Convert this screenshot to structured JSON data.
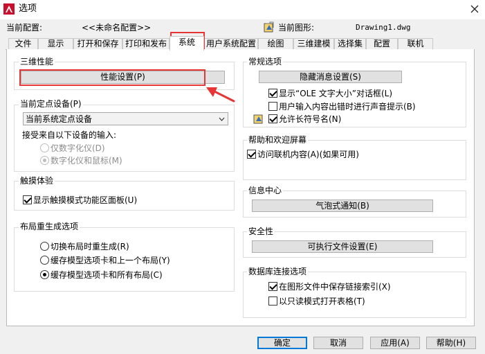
{
  "window": {
    "title": "选项"
  },
  "header": {
    "profile_label": "当前配置:",
    "profile_value": "<<未命名配置>>",
    "drawing_label": "当前图形:",
    "drawing_value": "Drawing1.dwg"
  },
  "tabs": [
    {
      "label": "文件"
    },
    {
      "label": "显示"
    },
    {
      "label": "打开和保存"
    },
    {
      "label": "打印和发布"
    },
    {
      "label": "系统"
    },
    {
      "label": "用户系统配置"
    },
    {
      "label": "绘图"
    },
    {
      "label": "三维建模"
    },
    {
      "label": "选择集"
    },
    {
      "label": "配置"
    },
    {
      "label": "联机"
    }
  ],
  "active_tab": "系统",
  "perf3d": {
    "title": "三维性能",
    "button": "性能设置(P)"
  },
  "pointing": {
    "title": "当前定点设备(P)",
    "selected": "当前系统定点设备",
    "accept_label": "接受来自以下设备的输入:",
    "opt_digitizer": "仅数字化仪(D)",
    "opt_digitizer_mouse": "数字化仪和鼠标(M)"
  },
  "touch": {
    "title": "触摸体验",
    "checkbox": "显示触摸模式功能区面板(U)"
  },
  "layout_regen": {
    "title": "布局重生成选项",
    "opt1": "切换布局时重生成(R)",
    "opt2": "缓存模型选项卡和上一个布局(Y)",
    "opt3": "缓存模型选项卡和所有布局(C)"
  },
  "general": {
    "title": "常规选项",
    "button": "隐藏消息设置(S)",
    "cb_ole": "显示“OLE 文字大小”对话框(L)",
    "cb_beep": "用户输入内容出错时进行声音提示(B)",
    "cb_longnames": "允许长符号名(N)"
  },
  "help": {
    "title": "帮助和欢迎屏幕",
    "checkbox": "访问联机内容(A)(如果可用)"
  },
  "info": {
    "title": "信息中心",
    "button": "气泡式通知(B)"
  },
  "security": {
    "title": "安全性",
    "button": "可执行文件设置(E)"
  },
  "db": {
    "title": "数据库连接选项",
    "cb_index": "在图形文件中保存链接索引(X)",
    "cb_readonly": "以只读模式打开表格(T)"
  },
  "footer": {
    "ok": "确定",
    "cancel": "取消",
    "apply": "应用(A)",
    "help": "帮助(H)"
  },
  "colors": {
    "highlight": "#e63535",
    "accent": "#0078d7"
  }
}
